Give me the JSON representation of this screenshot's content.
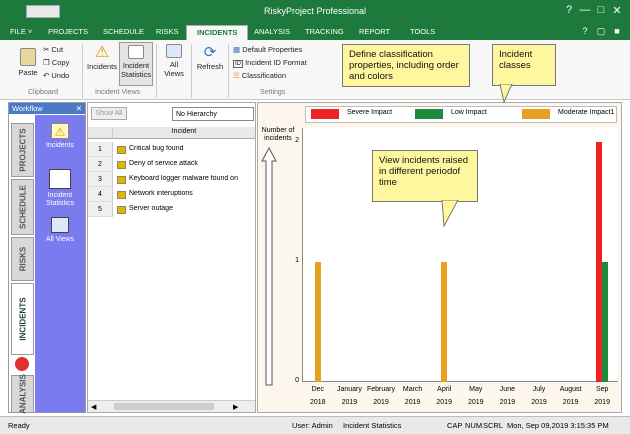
{
  "window": {
    "title": "RiskyProject Professional"
  },
  "tabs": [
    {
      "label": "FILE ˅"
    },
    {
      "label": "PROJECTS"
    },
    {
      "label": "SCHEDULE"
    },
    {
      "label": "RISKS"
    },
    {
      "label": "INCIDENTS"
    },
    {
      "label": "ANALYSIS"
    },
    {
      "label": "TRACKING"
    },
    {
      "label": "REPORT"
    },
    {
      "label": "TOOLS"
    }
  ],
  "ribbon": {
    "paste": "Paste",
    "cut": "Cut",
    "copy": "Copy",
    "undo": "Undo",
    "clipboard_group": "Clipboard",
    "incidents": "Incidents",
    "incident_statistics_1": "Incident",
    "incident_statistics_2": "Statistics",
    "incident_views_group": "Incident Views",
    "all_views_1": "All",
    "all_views_2": "Views",
    "refresh": "Refresh",
    "default_properties": "Default Properties",
    "incident_id_format": "Incident ID Format",
    "classification": "Classification",
    "settings_group": "Settings"
  },
  "workflow": {
    "title": "Workflow",
    "tabs": [
      "PROJECTS",
      "SCHEDULE",
      "RISKS",
      "INCIDENTS",
      "ANALYSIS"
    ],
    "items": [
      {
        "label": "Incidents"
      },
      {
        "label": "Incident Statistics"
      },
      {
        "label": "All Views"
      }
    ]
  },
  "list": {
    "show_all": "Show All",
    "hierarchy": "No Hierarchy",
    "column": "Incident",
    "rows": [
      {
        "num": "1",
        "text": "Critical bug found"
      },
      {
        "num": "2",
        "text": "Deny of service attack"
      },
      {
        "num": "3",
        "text": "Keyboard logger malware found on"
      },
      {
        "num": "4",
        "text": "Network interuptions"
      },
      {
        "num": "5",
        "text": "Server outage"
      }
    ]
  },
  "callouts": {
    "classification": "Define classification properties, including order and colors",
    "classes": "Incident classes",
    "periods": "View incidents raised in different periodof time"
  },
  "chart_data": {
    "type": "bar",
    "ylabel": "Number of incidents",
    "ylim": [
      0,
      2
    ],
    "yticks": [
      "0",
      "1",
      "2"
    ],
    "categories": [
      {
        "month": "Dec",
        "year": "2018"
      },
      {
        "month": "January",
        "year": "2019"
      },
      {
        "month": "February",
        "year": "2019"
      },
      {
        "month": "March",
        "year": "2019"
      },
      {
        "month": "April",
        "year": "2019"
      },
      {
        "month": "May",
        "year": "2019"
      },
      {
        "month": "June",
        "year": "2019"
      },
      {
        "month": "July",
        "year": "2019"
      },
      {
        "month": "August",
        "year": "2019"
      },
      {
        "month": "Sep",
        "year": "2019"
      }
    ],
    "series": [
      {
        "name": "Severe Impact",
        "color": "#ee2222",
        "values": [
          0,
          0,
          0,
          0,
          0,
          0,
          0,
          0,
          0,
          2
        ]
      },
      {
        "name": "Low Impact",
        "color": "#1e8a3c",
        "values": [
          0,
          0,
          0,
          0,
          0,
          0,
          0,
          0,
          0,
          1
        ]
      },
      {
        "name": "Moderate Impact1",
        "color": "#e8a020",
        "values": [
          1,
          0,
          0,
          0,
          1,
          0,
          0,
          0,
          0,
          0
        ]
      }
    ],
    "legend": "top"
  },
  "status": {
    "ready": "Ready",
    "user": "User: Admin",
    "view": "Incident Statistics",
    "cap": "CAP",
    "num": "NUM",
    "scrl": "SCRL",
    "datetime": "Mon, Sep 09,2019  3:15:35 PM"
  }
}
